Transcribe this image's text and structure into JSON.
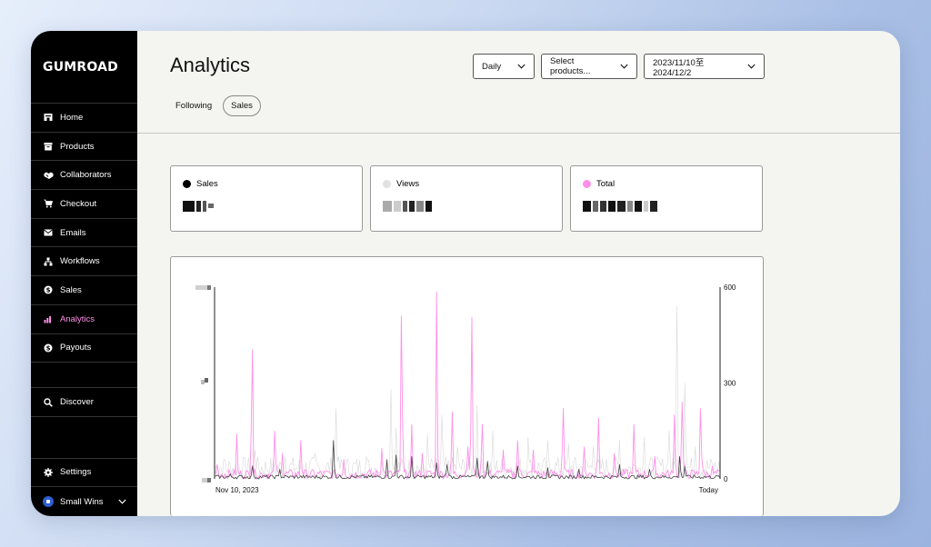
{
  "brand": {
    "logo_text": "GUMROAD"
  },
  "sidebar": {
    "items": [
      {
        "label": "Home",
        "icon": "home-icon"
      },
      {
        "label": "Products",
        "icon": "archive-icon"
      },
      {
        "label": "Collaborators",
        "icon": "handshake-icon"
      },
      {
        "label": "Checkout",
        "icon": "cart-icon"
      },
      {
        "label": "Emails",
        "icon": "envelope-icon"
      },
      {
        "label": "Workflows",
        "icon": "workflow-icon"
      },
      {
        "label": "Sales",
        "icon": "dollar-circle-icon"
      },
      {
        "label": "Analytics",
        "icon": "bar-chart-icon",
        "active": true
      },
      {
        "label": "Payouts",
        "icon": "dollar-circle-icon"
      }
    ],
    "discover": {
      "label": "Discover",
      "icon": "search-icon"
    },
    "settings": {
      "label": "Settings",
      "icon": "gear-icon"
    },
    "account": {
      "label": "Small Wins",
      "icon": "chevron-down-icon"
    }
  },
  "header": {
    "title": "Analytics",
    "tabs": [
      {
        "label": "Following",
        "active": false
      },
      {
        "label": "Sales",
        "active": true
      }
    ],
    "controls": {
      "granularity": "Daily",
      "products": "Select products...",
      "date_range": "2023/11/10至2024/12/2"
    }
  },
  "stats": [
    {
      "label": "Sales",
      "color": "#000000"
    },
    {
      "label": "Views",
      "color": "#e0e0e0"
    },
    {
      "label": "Total",
      "color": "#ff90e8"
    }
  ],
  "colors": {
    "accent_pink": "#ff90e8",
    "sidebar_bg": "#000000",
    "views_gray": "#d9d9d9",
    "sales_dark": "#444444"
  },
  "chart_data": {
    "type": "line",
    "x_start_label": "Nov 10, 2023",
    "x_end_label": "Today",
    "right_axis_ticks": [
      "600",
      "300",
      "0"
    ],
    "ylim_right": [
      0,
      600
    ],
    "grid": false,
    "series": [
      {
        "name": "Total",
        "color": "#ff90e8",
        "peaks": [
          {
            "x": 0.005,
            "y": 45
          },
          {
            "x": 0.045,
            "y": 140
          },
          {
            "x": 0.075,
            "y": 405
          },
          {
            "x": 0.12,
            "y": 150
          },
          {
            "x": 0.135,
            "y": 80
          },
          {
            "x": 0.17,
            "y": 120
          },
          {
            "x": 0.255,
            "y": 60
          },
          {
            "x": 0.33,
            "y": 95
          },
          {
            "x": 0.37,
            "y": 510
          },
          {
            "x": 0.39,
            "y": 170
          },
          {
            "x": 0.41,
            "y": 80
          },
          {
            "x": 0.44,
            "y": 585
          },
          {
            "x": 0.47,
            "y": 210
          },
          {
            "x": 0.5,
            "y": 100
          },
          {
            "x": 0.51,
            "y": 505
          },
          {
            "x": 0.53,
            "y": 170
          },
          {
            "x": 0.57,
            "y": 90
          },
          {
            "x": 0.6,
            "y": 120
          },
          {
            "x": 0.63,
            "y": 90
          },
          {
            "x": 0.69,
            "y": 220
          },
          {
            "x": 0.73,
            "y": 100
          },
          {
            "x": 0.76,
            "y": 190
          },
          {
            "x": 0.79,
            "y": 80
          },
          {
            "x": 0.83,
            "y": 170
          },
          {
            "x": 0.87,
            "y": 70
          },
          {
            "x": 0.91,
            "y": 200
          },
          {
            "x": 0.925,
            "y": 240
          },
          {
            "x": 0.96,
            "y": 220
          },
          {
            "x": 0.985,
            "y": 40
          }
        ]
      },
      {
        "name": "Views",
        "color": "#d9d9d9",
        "peaks": [
          {
            "x": 0.02,
            "y": 60
          },
          {
            "x": 0.08,
            "y": 90
          },
          {
            "x": 0.14,
            "y": 70
          },
          {
            "x": 0.2,
            "y": 80
          },
          {
            "x": 0.24,
            "y": 220
          },
          {
            "x": 0.3,
            "y": 70
          },
          {
            "x": 0.35,
            "y": 280
          },
          {
            "x": 0.36,
            "y": 160
          },
          {
            "x": 0.42,
            "y": 140
          },
          {
            "x": 0.45,
            "y": 200
          },
          {
            "x": 0.48,
            "y": 100
          },
          {
            "x": 0.52,
            "y": 230
          },
          {
            "x": 0.55,
            "y": 150
          },
          {
            "x": 0.62,
            "y": 130
          },
          {
            "x": 0.66,
            "y": 120
          },
          {
            "x": 0.7,
            "y": 110
          },
          {
            "x": 0.75,
            "y": 100
          },
          {
            "x": 0.8,
            "y": 120
          },
          {
            "x": 0.85,
            "y": 130
          },
          {
            "x": 0.9,
            "y": 150
          },
          {
            "x": 0.915,
            "y": 540
          },
          {
            "x": 0.93,
            "y": 300
          },
          {
            "x": 0.95,
            "y": 100
          }
        ]
      },
      {
        "name": "Sales",
        "color": "#444444",
        "peaks": [
          {
            "x": 0.03,
            "y": 15
          },
          {
            "x": 0.075,
            "y": 40
          },
          {
            "x": 0.13,
            "y": 30
          },
          {
            "x": 0.235,
            "y": 120
          },
          {
            "x": 0.34,
            "y": 60
          },
          {
            "x": 0.36,
            "y": 75
          },
          {
            "x": 0.39,
            "y": 70
          },
          {
            "x": 0.44,
            "y": 50
          },
          {
            "x": 0.46,
            "y": 45
          },
          {
            "x": 0.52,
            "y": 65
          },
          {
            "x": 0.54,
            "y": 55
          },
          {
            "x": 0.6,
            "y": 40
          },
          {
            "x": 0.66,
            "y": 35
          },
          {
            "x": 0.72,
            "y": 30
          },
          {
            "x": 0.8,
            "y": 45
          },
          {
            "x": 0.86,
            "y": 30
          },
          {
            "x": 0.92,
            "y": 70
          },
          {
            "x": 0.93,
            "y": 40
          }
        ]
      }
    ]
  }
}
